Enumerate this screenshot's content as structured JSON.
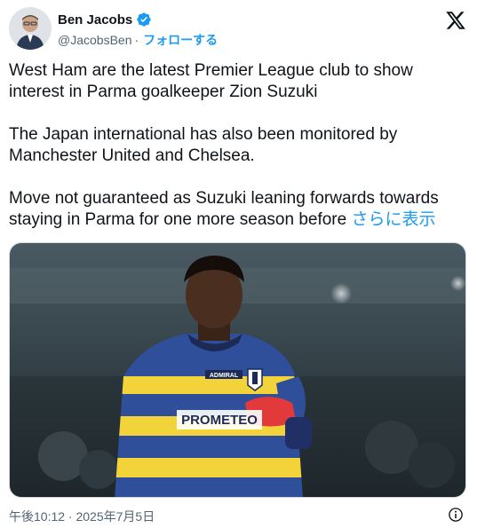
{
  "author": {
    "name": "Ben Jacobs",
    "handle": "@JacobsBen",
    "separator": "·",
    "follow_label": "フォローする"
  },
  "tweet": {
    "paragraph1": "West Ham are the latest Premier League club to show interest in Parma goalkeeper Zion Suzuki",
    "paragraph2": "The Japan international has also been monitored by Manchester United and Chelsea.",
    "paragraph3": "Move not guaranteed as Suzuki leaning forwards towards staying in Parma for one more season before",
    "show_more_label": "さらに表示"
  },
  "media": {
    "shirt_sponsor": "PROMETEO",
    "shirt_badge": "ADMIRAL"
  },
  "timestamp": "午後10:12 · 2025年7月5日",
  "colors": {
    "accent": "#1d9bf0",
    "text": "#0f1419",
    "secondary": "#536471"
  },
  "icons": {
    "verified": "verified-badge-icon",
    "platform": "x-logo-icon",
    "info": "info-icon"
  }
}
